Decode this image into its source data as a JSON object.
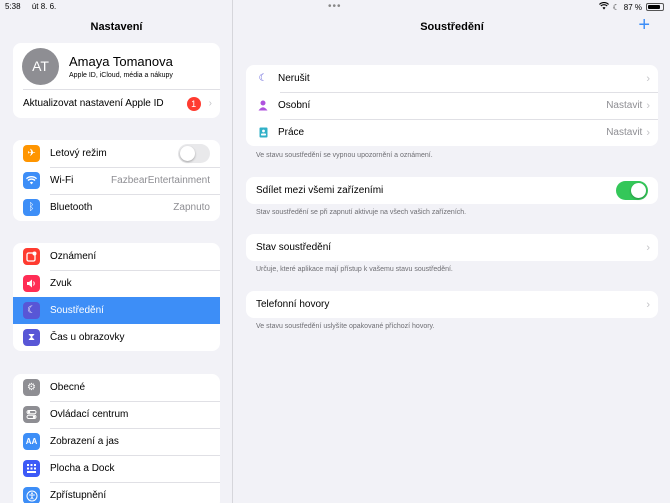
{
  "status": {
    "time": "5:38",
    "date": "út 8. 6.",
    "battery": "87 %",
    "battery_level": 0.87
  },
  "sidebar": {
    "title": "Nastavení",
    "profile": {
      "initials": "AT",
      "name": "Amaya Tomanova",
      "subtitle": "Apple ID, iCloud, média a nákupy",
      "update_label": "Aktualizovat nastavení Apple ID",
      "badge": "1"
    },
    "group1": [
      {
        "label": "Letový režim",
        "value": "",
        "color": "#ff9500",
        "icon": "airplane-icon"
      },
      {
        "label": "Wi-Fi",
        "value": "FazbearEntertainment",
        "color": "#3d8ef7",
        "icon": "wifi-icon"
      },
      {
        "label": "Bluetooth",
        "value": "Zapnuto",
        "color": "#3d8ef7",
        "icon": "bluetooth-icon"
      }
    ],
    "group2": [
      {
        "label": "Oznámení",
        "color": "#ff3b30",
        "icon": "notifications-icon"
      },
      {
        "label": "Zvuk",
        "color": "#ff2d55",
        "icon": "sound-icon"
      },
      {
        "label": "Soustředění",
        "color": "#5856d6",
        "icon": "moon-icon"
      },
      {
        "label": "Čas u obrazovky",
        "color": "#5856d6",
        "icon": "hourglass-icon"
      }
    ],
    "group3": [
      {
        "label": "Obecné",
        "color": "#8e8e93",
        "icon": "gear-icon"
      },
      {
        "label": "Ovládací centrum",
        "color": "#8e8e93",
        "icon": "control-center-icon"
      },
      {
        "label": "Zobrazení a jas",
        "color": "#3d8ef7",
        "icon": "display-icon"
      },
      {
        "label": "Plocha a Dock",
        "color": "#3d5af7",
        "icon": "home-screen-icon"
      },
      {
        "label": "Zpřístupnění",
        "color": "#3d8ef7",
        "icon": "accessibility-icon"
      }
    ]
  },
  "main": {
    "title": "Soustředění",
    "focus_modes": [
      {
        "label": "Nerušit",
        "value": "",
        "color": "#5856d6",
        "icon": "moon-icon"
      },
      {
        "label": "Osobní",
        "value": "Nastavit",
        "color": "#af52de",
        "icon": "person-icon"
      },
      {
        "label": "Práce",
        "value": "Nastavit",
        "color": "#30b0c7",
        "icon": "badge-icon"
      }
    ],
    "note1": "Ve stavu soustředění se vypnou upozornění a oznámení.",
    "share_label": "Sdílet mezi všemi zařízeními",
    "note2": "Stav soustředění se při zapnutí aktivuje na všech vašich zařízeních.",
    "focus_status_label": "Stav soustředění",
    "note3": "Určuje, které aplikace mají přístup k vašemu stavu soustředění.",
    "phone_calls_label": "Telefonní hovory",
    "note4": "Ve stavu soustředění uslyšíte opakované příchozí hovory."
  }
}
